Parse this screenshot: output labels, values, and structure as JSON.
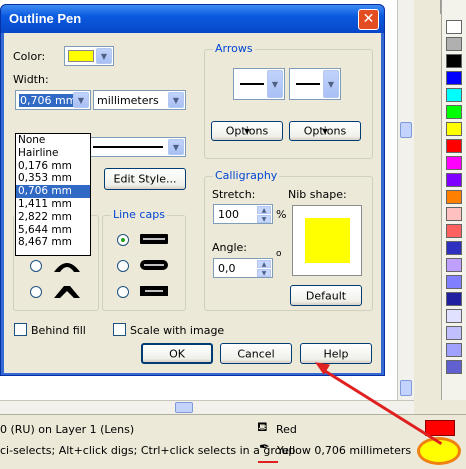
{
  "dialog": {
    "title": "Outline Pen",
    "close_glyph": "✕",
    "color_label": "Color:",
    "color_value": "#ffff00",
    "width_label": "Width:",
    "width_value": "0,706 mm",
    "units_value": "millimeters",
    "width_options": [
      "None",
      "Hairline",
      "0,176 mm",
      "0,353 mm",
      "0,706 mm",
      "1,411 mm",
      "2,822 mm",
      "5,644 mm",
      "8,467 mm"
    ],
    "width_selected_index": 4,
    "edit_style_label": "Edit Style...",
    "line_caps_title": "Line caps",
    "behind_fill_label": "Behind fill",
    "scale_with_image_label": "Scale with image",
    "arrows_title": "Arrows",
    "options_label_1": "Options",
    "options_label_2": "Options",
    "calligraphy_title": "Calligraphy",
    "stretch_label": "Stretch:",
    "stretch_value": "100",
    "stretch_unit": "%",
    "angle_label": "Angle:",
    "angle_value": "0,0",
    "angle_unit": "o",
    "nib_shape_label": "Nib shape:",
    "default_label": "Default",
    "ok_label": "OK",
    "cancel_label": "Cancel",
    "help_label": "Help"
  },
  "status_bar": {
    "line1": "0 (RU) on Layer 1  (Lens)",
    "line2": "ci-selects; Alt+click digs; Ctrl+click selects in a group",
    "fill_name": "Red",
    "outline_info": "Yellow  0,706 millimeters"
  },
  "colors": {
    "accent": "#0046d5",
    "fill": "#ff0000",
    "outline": "#ffff00",
    "annotation": "#e02020"
  },
  "palette": [
    "#ffffff",
    "#b0b0b0",
    "#000000",
    "#0000ff",
    "#00ffff",
    "#00ff00",
    "#ffff00",
    "#ff0000",
    "#ff00ff",
    "#8000ff",
    "#ff8000",
    "#ffc0c0",
    "#ff6060",
    "#3030c0",
    "#c0a0ff",
    "#8080ff",
    "#2020a0",
    "#e0e0ff",
    "#c0c0ff",
    "#a0a0ff",
    "#6060d0"
  ]
}
